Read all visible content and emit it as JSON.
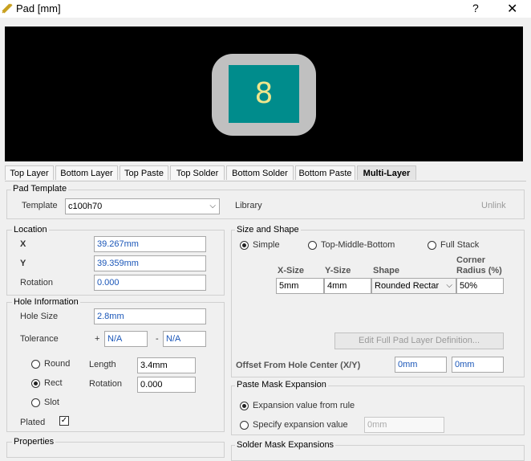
{
  "window": {
    "title": "Pad [mm]",
    "help": "?",
    "close": "✕"
  },
  "preview": {
    "pad_designator": "8",
    "pad_outer_color": "#c0c0c0",
    "pad_inner_color": "#008c8c",
    "text_color": "#f0e68c"
  },
  "tabs": [
    "Top Layer",
    "Bottom Layer",
    "Top Paste",
    "Top Solder",
    "Bottom Solder",
    "Bottom Paste",
    "Multi-Layer"
  ],
  "active_tab": "Multi-Layer",
  "pad_template": {
    "group": "Pad Template",
    "template_label": "Template",
    "template_value": "c100h70",
    "library_label": "Library",
    "unlink": "Unlink"
  },
  "location": {
    "group": "Location",
    "x_label": "X",
    "x_value": "39.267mm",
    "y_label": "Y",
    "y_value": "39.359mm",
    "rotation_label": "Rotation",
    "rotation_value": "0.000"
  },
  "hole": {
    "group": "Hole Information",
    "size_label": "Hole Size",
    "size_value": "2.8mm",
    "tolerance_label": "Tolerance",
    "plus": "+",
    "plus_value": "N/A",
    "minus": "-",
    "minus_value": "N/A",
    "round": "Round",
    "rect": "Rect",
    "slot": "Slot",
    "selected": "Rect",
    "length_label": "Length",
    "length_value": "3.4mm",
    "rotation_label": "Rotation",
    "rotation_value": "0.000",
    "plated_label": "Plated",
    "plated": true
  },
  "properties": {
    "group": "Properties"
  },
  "size_shape": {
    "group": "Size and Shape",
    "simple": "Simple",
    "tmb": "Top-Middle-Bottom",
    "full": "Full Stack",
    "selected": "Simple",
    "col_x": "X-Size",
    "col_y": "Y-Size",
    "col_shape": "Shape",
    "col_corner_1": "Corner",
    "col_corner_2": "Radius (%)",
    "x_value": "5mm",
    "y_value": "4mm",
    "shape_value": "Rounded Rectar",
    "corner_value": "50%",
    "edit_button": "Edit Full Pad Layer Definition...",
    "offset_label": "Offset From Hole Center (X/Y)",
    "offset_x": "0mm",
    "offset_y": "0mm"
  },
  "paste": {
    "group": "Paste Mask Expansion",
    "rule": "Expansion value from rule",
    "specify": "Specify expansion value",
    "value": "0mm"
  },
  "solder": {
    "group": "Solder Mask Expansions"
  }
}
